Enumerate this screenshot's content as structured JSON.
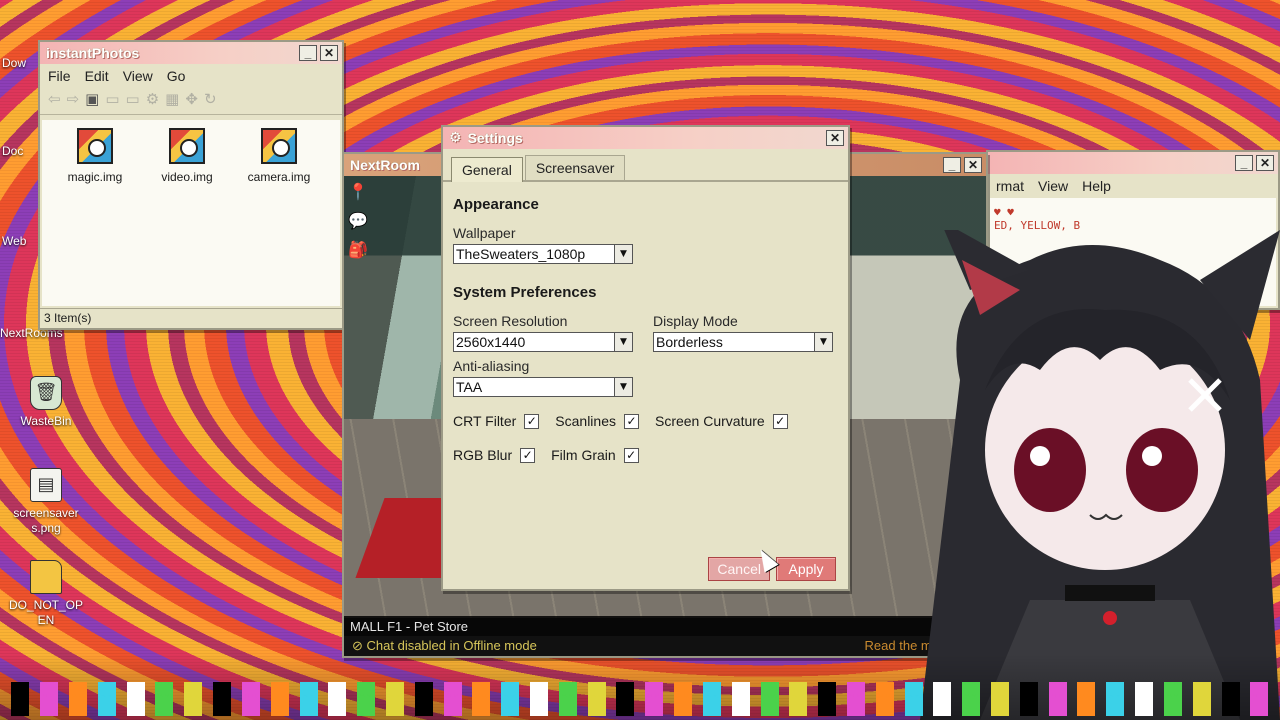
{
  "desktop": {
    "icons": [
      {
        "label": "WasteBin",
        "icon": "trash-bin-icon"
      },
      {
        "label": "screensaver s.png",
        "icon": "image-file-icon"
      },
      {
        "label": "DO_NOT_OP EN",
        "icon": "folder-icon"
      }
    ],
    "partial_labels": [
      "Dow",
      "Doc",
      "Web",
      "NextRooms"
    ]
  },
  "photos_window": {
    "title": "instantPhotos",
    "menu": [
      "File",
      "Edit",
      "View",
      "Go"
    ],
    "files": [
      "magic.img",
      "video.img",
      "camera.img"
    ],
    "status": "3 Item(s)"
  },
  "next_window": {
    "title": "NextRoom",
    "location": "MALL F1 - Pet Store",
    "chat_status": "Chat disabled in Offline mode",
    "manual_hint": "Read the manual fo"
  },
  "note_window": {
    "menu": [
      "rmat",
      "View",
      "Help"
    ],
    "content": "ED, YELLOW, B"
  },
  "settings": {
    "title": "Settings",
    "tabs": [
      "General",
      "Screensaver"
    ],
    "appearance_title": "Appearance",
    "wallpaper_label": "Wallpaper",
    "wallpaper_value": "TheSweaters_1080p",
    "system_title": "System Preferences",
    "resolution_label": "Screen Resolution",
    "resolution_value": "2560x1440",
    "display_mode_label": "Display Mode",
    "display_mode_value": "Borderless",
    "aa_label": "Anti-aliasing",
    "aa_value": "TAA",
    "checkboxes": [
      {
        "label": "CRT Filter",
        "checked": true
      },
      {
        "label": "Scanlines",
        "checked": true
      },
      {
        "label": "Screen Curvature",
        "checked": true
      },
      {
        "label": "RGB Blur",
        "checked": true
      },
      {
        "label": "Film Grain",
        "checked": true
      }
    ],
    "cancel_label": "Cancel",
    "apply_label": "Apply"
  },
  "crowd_colors": [
    "#000000",
    "#e44fd1",
    "#ff8a1f",
    "#3bd1e8",
    "#ffffff",
    "#4bd24b",
    "#e0d63b"
  ],
  "colors": {
    "accent": "#e07a78",
    "title_gradient_start": "#f4b4b4",
    "window_bg": "#e6e3c8"
  }
}
